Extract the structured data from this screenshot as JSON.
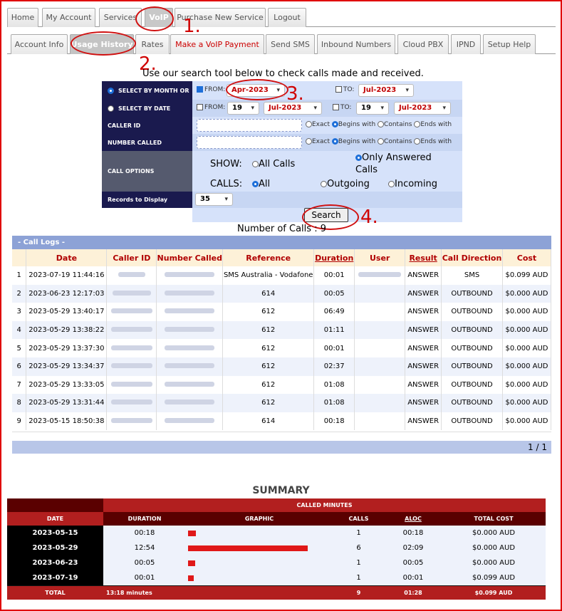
{
  "nav": {
    "main_tabs": [
      "Home",
      "My Account",
      "Services",
      "VoIP",
      "Purchase New Service",
      "Logout"
    ],
    "sub_tabs": [
      "Account Info",
      "Usage History",
      "Rates",
      "Make a VoIP Payment",
      "Send SMS",
      "Inbound Numbers",
      "Cloud PBX",
      "IPND",
      "Setup Help"
    ]
  },
  "annotations": [
    "1.",
    "2.",
    "3.",
    "4."
  ],
  "intro": "Use our search tool below to check calls made and received.",
  "search": {
    "select_by_month": "SELECT BY MONTH OR",
    "select_by_date": "SELECT BY DATE",
    "from_label": "FROM:",
    "to_label": "TO:",
    "from_month": "Apr-2023",
    "to_month": "Jul-2023",
    "date_from_day": "19",
    "date_from_month": "Jul-2023",
    "date_to_day": "19",
    "date_to_month": "Jul-2023",
    "caller_id": "CALLER ID",
    "number_called": "NUMBER CALLED",
    "match": [
      "Exact",
      "Begins with",
      "Contains",
      "Ends with"
    ],
    "call_options": "CALL OPTIONS",
    "show_label": "SHOW:",
    "all_calls": "All Calls",
    "only_answered": "Only Answered Calls",
    "calls_label": "CALLS:",
    "all": "All",
    "outgoing": "Outgoing",
    "incoming": "Incoming",
    "records_label": "Records to Display",
    "records_value": "35",
    "button": "Search"
  },
  "number_of_calls": "Number of Calls : 9",
  "call_logs": {
    "title": "- Call Logs -",
    "headers": [
      "Date",
      "Caller ID",
      "Number Called",
      "Reference",
      "Duration",
      "User",
      "Result",
      "Call Direction",
      "Cost"
    ],
    "rows": [
      {
        "n": "1",
        "date": "2023-07-19 11:44:16",
        "ref": "SMS Australia - Vodafone",
        "dur": "00:01",
        "result": "ANSWER",
        "dir": "SMS",
        "cost": "$0.099 AUD"
      },
      {
        "n": "2",
        "date": "2023-06-23 12:17:03",
        "ref": "614",
        "dur": "00:05",
        "result": "ANSWER",
        "dir": "OUTBOUND",
        "cost": "$0.000 AUD"
      },
      {
        "n": "3",
        "date": "2023-05-29 13:40:17",
        "ref": "612",
        "dur": "06:49",
        "result": "ANSWER",
        "dir": "OUTBOUND",
        "cost": "$0.000 AUD"
      },
      {
        "n": "4",
        "date": "2023-05-29 13:38:22",
        "ref": "612",
        "dur": "01:11",
        "result": "ANSWER",
        "dir": "OUTBOUND",
        "cost": "$0.000 AUD"
      },
      {
        "n": "5",
        "date": "2023-05-29 13:37:30",
        "ref": "612",
        "dur": "00:01",
        "result": "ANSWER",
        "dir": "OUTBOUND",
        "cost": "$0.000 AUD"
      },
      {
        "n": "6",
        "date": "2023-05-29 13:34:37",
        "ref": "612",
        "dur": "02:37",
        "result": "ANSWER",
        "dir": "OUTBOUND",
        "cost": "$0.000 AUD"
      },
      {
        "n": "7",
        "date": "2023-05-29 13:33:05",
        "ref": "612",
        "dur": "01:08",
        "result": "ANSWER",
        "dir": "OUTBOUND",
        "cost": "$0.000 AUD"
      },
      {
        "n": "8",
        "date": "2023-05-29 13:31:44",
        "ref": "612",
        "dur": "01:08",
        "result": "ANSWER",
        "dir": "OUTBOUND",
        "cost": "$0.000 AUD"
      },
      {
        "n": "9",
        "date": "2023-05-15 18:50:38",
        "ref": "614",
        "dur": "00:18",
        "result": "ANSWER",
        "dir": "OUTBOUND",
        "cost": "$0.000 AUD"
      }
    ],
    "pager": "1 / 1"
  },
  "summary": {
    "title": "SUMMARY",
    "group": "CALLED MINUTES",
    "headers": [
      "DATE",
      "DURATION",
      "GRAPHIC",
      "CALLS",
      "ALOC",
      "TOTAL COST"
    ],
    "rows": [
      {
        "date": "2023-05-15",
        "dur": "00:18",
        "level": 0.065,
        "calls": "1",
        "aloc": "00:18",
        "cost": "$0.000 AUD"
      },
      {
        "date": "2023-05-29",
        "dur": "12:54",
        "level": 1.0,
        "calls": "6",
        "aloc": "02:09",
        "cost": "$0.000 AUD"
      },
      {
        "date": "2023-06-23",
        "dur": "00:05",
        "level": 0.06,
        "calls": "1",
        "aloc": "00:05",
        "cost": "$0.000 AUD"
      },
      {
        "date": "2023-07-19",
        "dur": "00:01",
        "level": 0.05,
        "calls": "1",
        "aloc": "00:01",
        "cost": "$0.099 AUD"
      }
    ],
    "total": {
      "label": "TOTAL",
      "dur": "13:18 minutes",
      "calls": "9",
      "aloc": "01:28",
      "cost": "$0.099 AUD"
    }
  },
  "colors": {
    "accent": "#cc0000",
    "nav_dark": "#1a1a4e",
    "panel": "#d6e2fa",
    "summary_red": "#b22222"
  }
}
